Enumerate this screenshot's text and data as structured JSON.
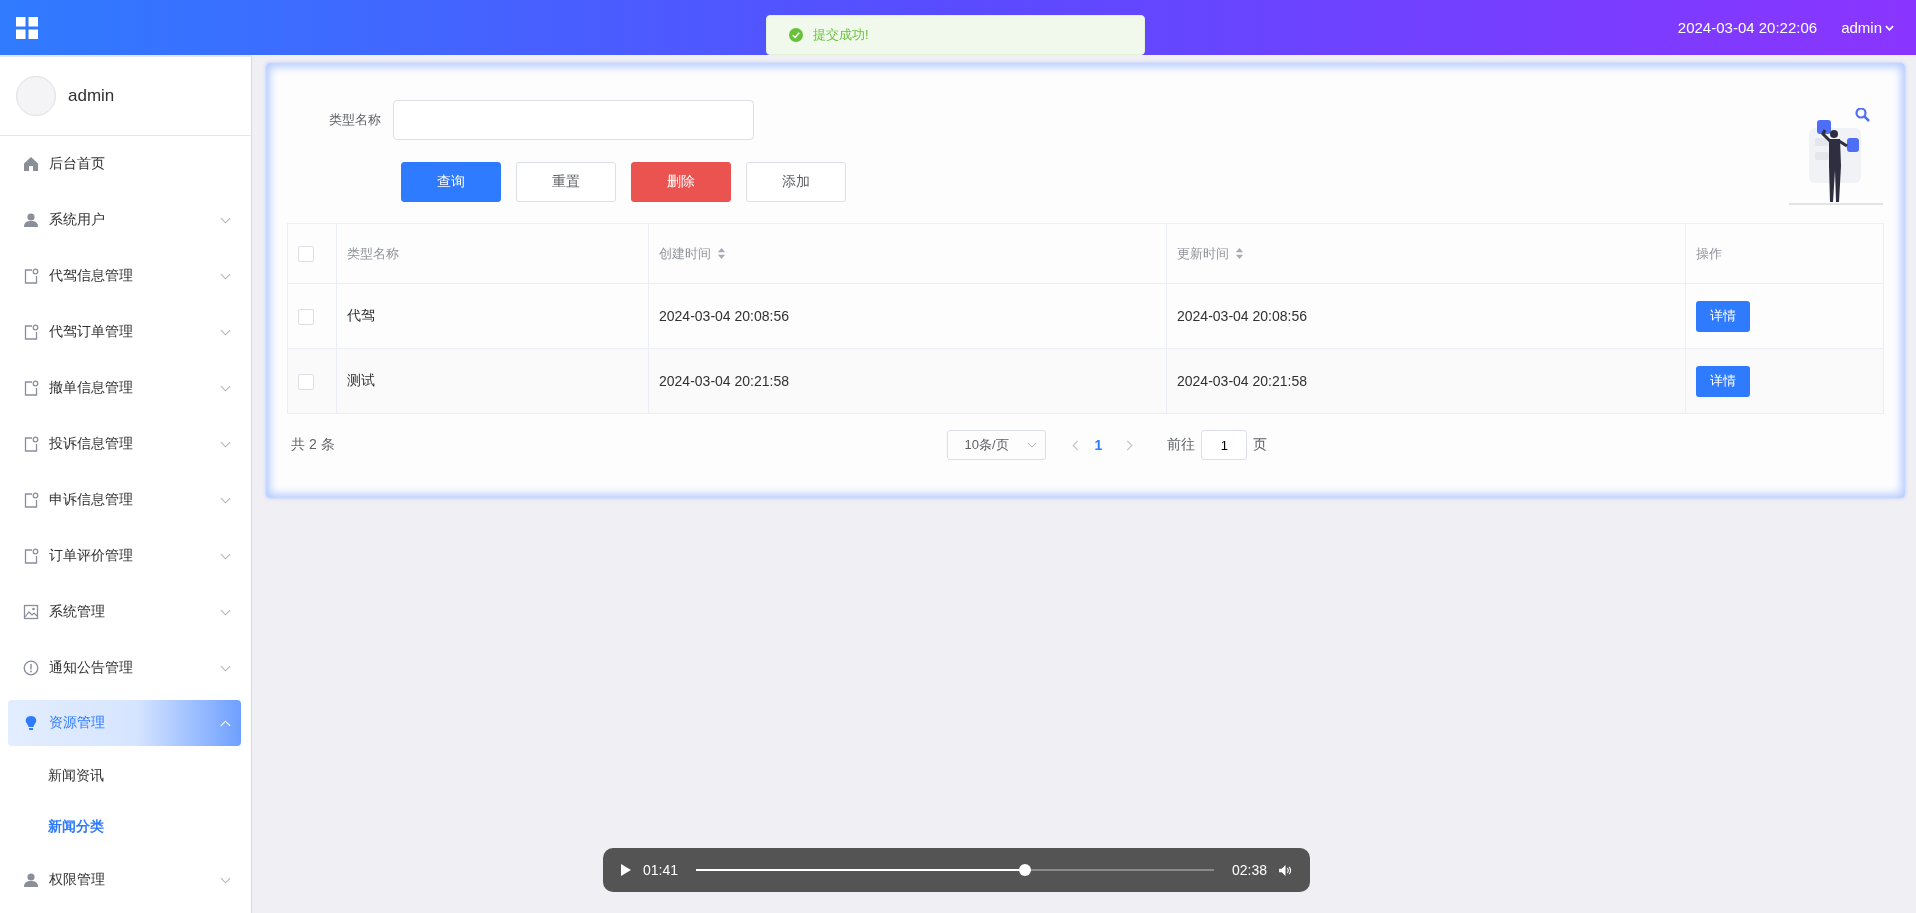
{
  "topbar": {
    "datetime": "2024-03-04 20:22:06",
    "user": "admin"
  },
  "toast": {
    "message": "提交成功!"
  },
  "sidebar": {
    "user": "admin",
    "items": [
      {
        "label": "后台首页",
        "kind": "home",
        "expandable": false,
        "selected": false
      },
      {
        "label": "系统用户",
        "kind": "user",
        "expandable": true,
        "expanded": false,
        "selected": false
      },
      {
        "label": "代驾信息管理",
        "kind": "doc",
        "expandable": true,
        "expanded": false,
        "selected": false
      },
      {
        "label": "代驾订单管理",
        "kind": "doc",
        "expandable": true,
        "expanded": false,
        "selected": false
      },
      {
        "label": "撤单信息管理",
        "kind": "doc",
        "expandable": true,
        "expanded": false,
        "selected": false
      },
      {
        "label": "投诉信息管理",
        "kind": "doc",
        "expandable": true,
        "expanded": false,
        "selected": false
      },
      {
        "label": "申诉信息管理",
        "kind": "doc",
        "expandable": true,
        "expanded": false,
        "selected": false
      },
      {
        "label": "订单评价管理",
        "kind": "doc",
        "expandable": true,
        "expanded": false,
        "selected": false
      },
      {
        "label": "系统管理",
        "kind": "picture",
        "expandable": true,
        "expanded": false,
        "selected": false
      },
      {
        "label": "通知公告管理",
        "kind": "notice",
        "expandable": true,
        "expanded": false,
        "selected": false
      },
      {
        "label": "资源管理",
        "kind": "bulb",
        "expandable": true,
        "expanded": true,
        "selected": true,
        "children": [
          {
            "label": "新闻资讯",
            "selected": false
          },
          {
            "label": "新闻分类",
            "selected": true
          }
        ]
      },
      {
        "label": "权限管理",
        "kind": "user",
        "expandable": true,
        "expanded": false,
        "selected": false
      }
    ]
  },
  "search": {
    "label": "类型名称"
  },
  "buttons": [
    {
      "label": "查询",
      "kind": "primary"
    },
    {
      "label": "重置",
      "kind": "plain"
    },
    {
      "label": "删除",
      "kind": "danger"
    },
    {
      "label": "添加",
      "kind": "plain"
    }
  ],
  "table": {
    "header_checked": false,
    "columns": [
      {
        "label": "类型名称",
        "sortable": false
      },
      {
        "label": "创建时间",
        "sortable": true
      },
      {
        "label": "更新时间",
        "sortable": true
      },
      {
        "label": "操作",
        "sortable": false
      }
    ],
    "rows": [
      {
        "checked": false,
        "cells": [
          "代驾",
          "2024-03-04 20:08:56",
          "2024-03-04 20:08:56"
        ],
        "action": "详情"
      },
      {
        "checked": false,
        "cells": [
          "测试",
          "2024-03-04 20:21:58",
          "2024-03-04 20:21:58"
        ],
        "action": "详情"
      }
    ]
  },
  "pagination": {
    "total": "共 2 条",
    "page_size": "10条/页",
    "pages": [
      {
        "label": "1",
        "selected": true
      }
    ],
    "goto_label": "前往",
    "goto_value": "1",
    "goto_suffix": "页"
  },
  "audio": {
    "current": "01:41",
    "duration": "02:38",
    "level": 0.636
  }
}
